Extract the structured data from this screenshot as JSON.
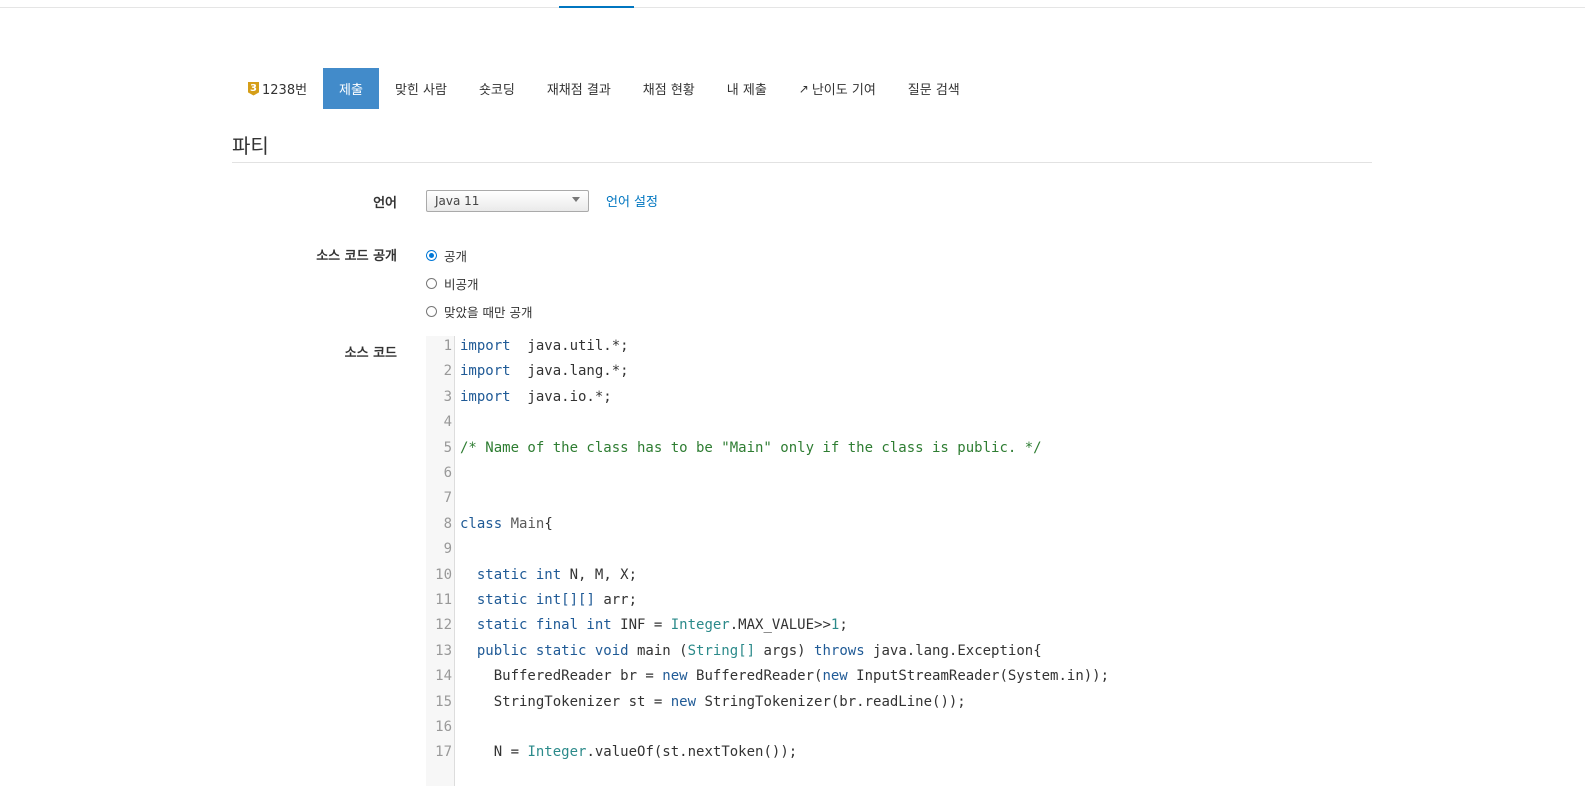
{
  "tabs": [
    {
      "label": "1238번",
      "badge": "3",
      "active": false
    },
    {
      "label": "제출",
      "active": true
    },
    {
      "label": "맞힌 사람",
      "active": false
    },
    {
      "label": "숏코딩",
      "active": false
    },
    {
      "label": "재채점 결과",
      "active": false
    },
    {
      "label": "채점 현황",
      "active": false
    },
    {
      "label": "내 제출",
      "active": false
    },
    {
      "label": "난이도 기여",
      "active": false,
      "icon": "external-link-icon"
    },
    {
      "label": "질문 검색",
      "active": false
    }
  ],
  "page_title": "파티",
  "form": {
    "language_label": "언어",
    "language_value": "Java 11",
    "language_settings_link": "언어 설정",
    "visibility_label": "소스 코드 공개",
    "visibility_options": [
      {
        "label": "공개",
        "checked": true
      },
      {
        "label": "비공개",
        "checked": false
      },
      {
        "label": "맞았을 때만 공개",
        "checked": false
      }
    ],
    "source_label": "소스 코드"
  },
  "code_lines": [
    {
      "n": "1",
      "t": [
        [
          "kw",
          "import"
        ],
        [
          "",
          "  java.util.*;"
        ]
      ]
    },
    {
      "n": "2",
      "t": [
        [
          "kw",
          "import"
        ],
        [
          "",
          "  java.lang.*;"
        ]
      ]
    },
    {
      "n": "3",
      "t": [
        [
          "kw",
          "import"
        ],
        [
          "",
          "  java.io.*;"
        ]
      ]
    },
    {
      "n": "4",
      "t": []
    },
    {
      "n": "5",
      "t": [
        [
          "cm",
          "/* Name of the class has to be \"Main\" only if the class is public. */"
        ]
      ]
    },
    {
      "n": "6",
      "t": []
    },
    {
      "n": "7",
      "t": []
    },
    {
      "n": "8",
      "t": [
        [
          "kw",
          "class"
        ],
        [
          "",
          " "
        ],
        [
          "cl",
          "Main"
        ],
        [
          "",
          "{"
        ]
      ]
    },
    {
      "n": "9",
      "t": []
    },
    {
      "n": "10",
      "t": [
        [
          "",
          "  "
        ],
        [
          "kw",
          "static"
        ],
        [
          "",
          " "
        ],
        [
          "kw",
          "int"
        ],
        [
          "",
          " N, M, X;"
        ]
      ]
    },
    {
      "n": "11",
      "t": [
        [
          "",
          "  "
        ],
        [
          "kw",
          "static"
        ],
        [
          "",
          " "
        ],
        [
          "kw",
          "int[][]"
        ],
        [
          "",
          " arr;"
        ]
      ]
    },
    {
      "n": "12",
      "t": [
        [
          "",
          "  "
        ],
        [
          "kw",
          "static final int"
        ],
        [
          "",
          " INF = "
        ],
        [
          "ty",
          "Integer"
        ],
        [
          "",
          ".MAX_VALUE>>"
        ],
        [
          "ty",
          "1"
        ],
        [
          "",
          ";"
        ]
      ]
    },
    {
      "n": "13",
      "t": [
        [
          "",
          "  "
        ],
        [
          "kw",
          "public static void"
        ],
        [
          "",
          " main ("
        ],
        [
          "ty",
          "String[]"
        ],
        [
          "",
          " args) "
        ],
        [
          "kw",
          "throws"
        ],
        [
          "",
          " java.lang.Exception{"
        ]
      ]
    },
    {
      "n": "14",
      "t": [
        [
          "",
          "    BufferedReader br = "
        ],
        [
          "kw",
          "new"
        ],
        [
          "",
          " BufferedReader("
        ],
        [
          "kw",
          "new"
        ],
        [
          "",
          " InputStreamReader(System.in));"
        ]
      ]
    },
    {
      "n": "15",
      "t": [
        [
          "",
          "    StringTokenizer st = "
        ],
        [
          "kw",
          "new"
        ],
        [
          "",
          " StringTokenizer(br.readLine());"
        ]
      ]
    },
    {
      "n": "16",
      "t": []
    },
    {
      "n": "17",
      "t": [
        [
          "",
          "    N = "
        ],
        [
          "ty",
          "Integer"
        ],
        [
          "",
          ".valueOf(st.nextToken());"
        ]
      ]
    }
  ]
}
